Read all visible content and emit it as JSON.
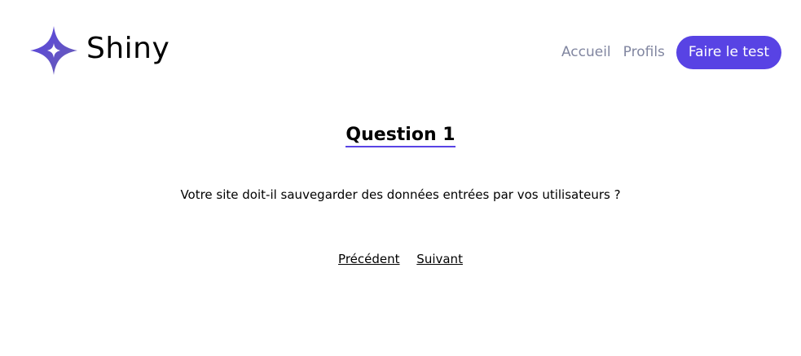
{
  "header": {
    "logo_text": "Shiny",
    "nav": {
      "home_label": "Accueil",
      "profiles_label": "Profils",
      "cta_label": "Faire le test"
    }
  },
  "survey": {
    "question_title": "Question 1",
    "question_text": "Votre site doit-il sauvegarder des données entrées par vos utilisateurs ?",
    "previous_label": "Précédent",
    "next_label": "Suivant"
  },
  "colors": {
    "accent": "#5843e4",
    "nav_text": "#8186a0",
    "logo_gradient_start": "#5843e4",
    "logo_gradient_end": "#6e64a8"
  }
}
